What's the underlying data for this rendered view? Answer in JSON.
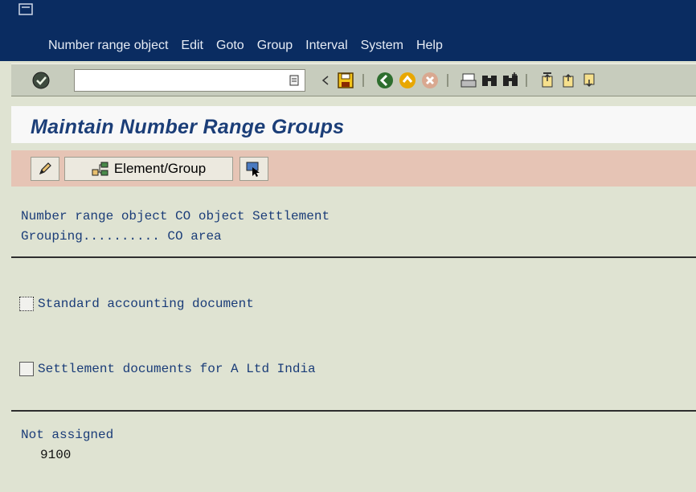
{
  "menu": {
    "items": [
      {
        "label": "Number range object"
      },
      {
        "label": "Edit"
      },
      {
        "label": "Goto"
      },
      {
        "label": "Group"
      },
      {
        "label": "Interval"
      },
      {
        "label": "System"
      },
      {
        "label": "Help"
      }
    ]
  },
  "toolbar": {
    "command_value": ""
  },
  "page": {
    "title": "Maintain Number Range Groups"
  },
  "app_toolbar": {
    "element_group_label": "Element/Group"
  },
  "info": {
    "line1": "Number range object CO object Settlement",
    "line2": "Grouping.......... CO area"
  },
  "groups": [
    {
      "label": "Standard accounting document"
    },
    {
      "label": "Settlement documents for A Ltd India"
    }
  ],
  "not_assigned": {
    "heading": "Not assigned",
    "value": "9100"
  },
  "colors": {
    "menubar": "#0a2c61",
    "title": "#1b3e78",
    "app_toolbar": "#e6c4b5",
    "background": "#dfe3d2"
  }
}
